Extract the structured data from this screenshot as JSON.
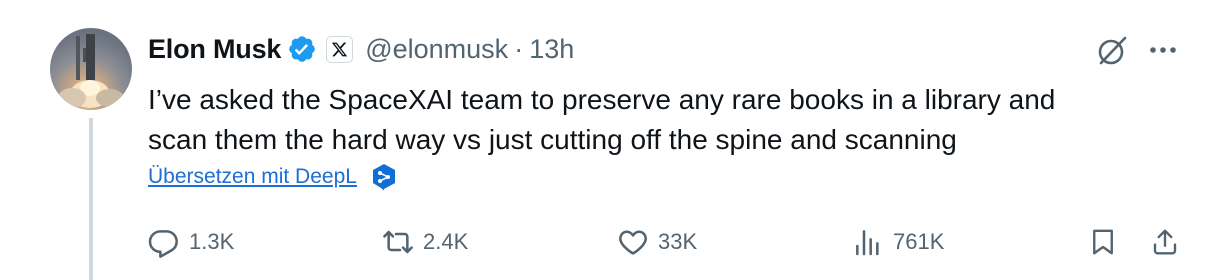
{
  "author": {
    "name": "Elon Musk",
    "handle": "@elonmusk",
    "separator": "·",
    "time": "13h"
  },
  "tweet": {
    "lines": [
      "I’ve asked the SpaceXAI team to preserve any rare books in a library and",
      "scan them the hard way vs just cutting off the spine and scanning"
    ]
  },
  "translate": {
    "label": "Übersetzen mit DeepL"
  },
  "actions": {
    "replies": "1.3K",
    "reposts": "2.4K",
    "likes": "33K",
    "views": "761K"
  },
  "colors": {
    "verified": "#1d9bf0",
    "link": "#1d6fd6",
    "muted": "#536471",
    "text": "#0f1419",
    "deepl": "#0f6fd6"
  },
  "icons": [
    "verified-badge-icon",
    "x-logo-icon",
    "grok-icon",
    "more-icon",
    "deepl-icon",
    "reply-icon",
    "repost-icon",
    "like-icon",
    "views-icon",
    "bookmark-icon",
    "share-icon"
  ]
}
